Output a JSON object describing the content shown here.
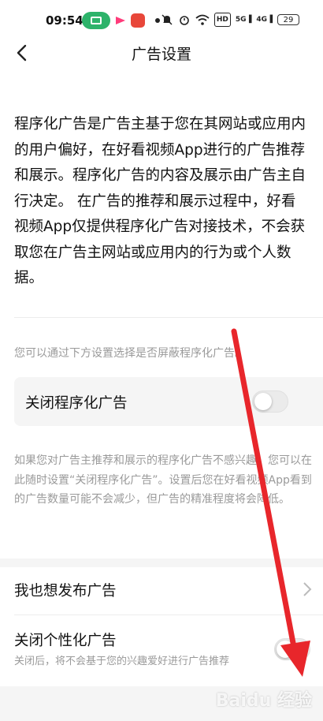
{
  "status_bar": {
    "time": "09:54",
    "battery": "29",
    "signal_labels": [
      "HD",
      "5G",
      "4G"
    ]
  },
  "header": {
    "title": "广告设置",
    "back_icon": "chevron-left-icon"
  },
  "intro_text": "程序化广告是广告主基于您在其网站或应用内的用户偏好，在好看视频App进行的广告推荐和展示。程序化广告的内容及展示由广告主自行决定。 在广告的推荐和展示过程中，好看视频App仅提供程序化广告对接技术，不会获取您在广告主网站或应用内的行为或个人数据。",
  "hint_text": "您可以通过下方设置选择是否屏蔽程序化广告。",
  "programmatic_toggle": {
    "label": "关闭程序化广告",
    "enabled": false
  },
  "programmatic_desc": "如果您对广告主推荐和展示的程序化广告不感兴趣，您可以在此随时设置“关闭程序化广告”。设置后您在好看视频App看到的广告数量可能不会减少，但广告的精准程度将会降低。",
  "publish_row": {
    "label": "我也想发布广告",
    "icon": "chevron-right-icon"
  },
  "personalized_toggle": {
    "label": "关闭个性化广告",
    "sublabel": "关闭后，将不会基于您的兴趣爱好进行广告推荐",
    "enabled": false
  },
  "watermark": "Baidu 经验",
  "colors": {
    "annotation_arrow": "#e8262b",
    "card_bg": "#f5f5f5",
    "secondary_text": "#9a9a9a",
    "status_pill": "#2db36a"
  }
}
